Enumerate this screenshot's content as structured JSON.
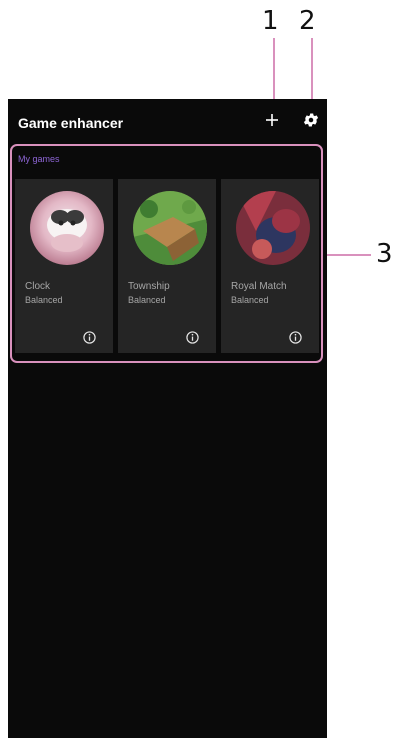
{
  "callouts": [
    "1",
    "2",
    "3"
  ],
  "header": {
    "title": "Game enhancer",
    "add_icon": "plus-icon",
    "settings_icon": "gear-icon"
  },
  "my_games": {
    "label": "My games",
    "games": [
      {
        "name": "Clock",
        "mode": "Balanced"
      },
      {
        "name": "Township",
        "mode": "Balanced"
      },
      {
        "name": "Royal Match",
        "mode": "Balanced"
      }
    ]
  },
  "colors": {
    "background": "#0a0a0a",
    "card": "#252525",
    "section_label": "#8e66d6",
    "callout_highlight": "#d991bd"
  }
}
